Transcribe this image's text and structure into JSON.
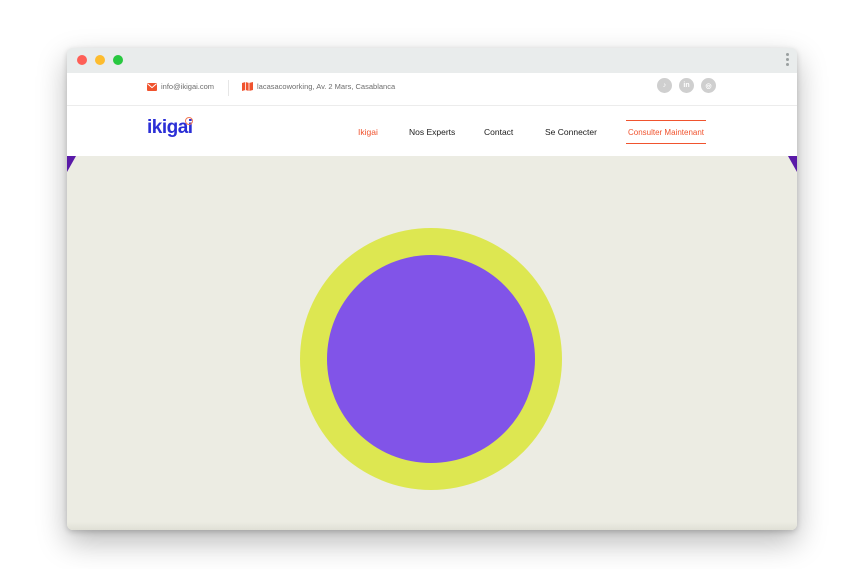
{
  "topbar": {
    "email": "info@ikigai.com",
    "address": "lacasacoworking, Av. 2 Mars, Casablanca",
    "social": [
      {
        "icon": "tiktok-icon",
        "glyph": "♪"
      },
      {
        "icon": "linkedin-icon",
        "glyph": "in"
      },
      {
        "icon": "instagram-icon",
        "glyph": "◎"
      }
    ]
  },
  "navbar": {
    "logo": "ikigai",
    "links": [
      "Ikigai",
      "Nos Experts",
      "Contact",
      "Se Connecter"
    ],
    "active_link": "Ikigai",
    "cta": "Consulter Maintenant"
  },
  "colors": {
    "accent": "#f0532e",
    "brand": "#2b2fd6",
    "hero_background": "#ecece3",
    "ring": "#dde751",
    "circle": "#8154e8",
    "corner": "#5a1aa8"
  }
}
